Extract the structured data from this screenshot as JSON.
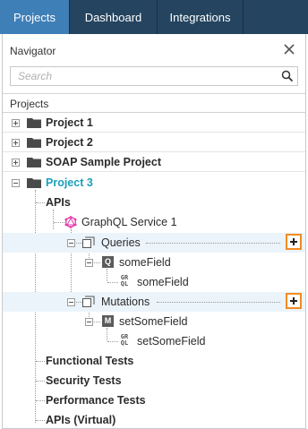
{
  "tabs": [
    {
      "label": "Projects",
      "active": true
    },
    {
      "label": "Dashboard",
      "active": false
    },
    {
      "label": "Integrations",
      "active": false
    }
  ],
  "navigator": {
    "title": "Navigator",
    "search_placeholder": "Search",
    "tree_heading": "Projects"
  },
  "projects": [
    {
      "label": "Project 1",
      "expanded": false
    },
    {
      "label": "Project 2",
      "expanded": false
    },
    {
      "label": "SOAP Sample Project",
      "expanded": false
    },
    {
      "label": "Project 3",
      "expanded": true
    }
  ],
  "tree": {
    "apis": "APIs",
    "graphql_service": "GraphQL Service 1",
    "queries": "Queries",
    "query_field": "someField",
    "query_field_op": "someField",
    "mutations": "Mutations",
    "mutation_field": "setSomeField",
    "mutation_field_op": "setSomeField",
    "functional_tests": "Functional Tests",
    "security_tests": "Security Tests",
    "performance_tests": "Performance Tests",
    "apis_virtual": "APIs (Virtual)"
  },
  "icons": {
    "query_badge": "Q",
    "mutation_badge": "M",
    "graphql_top": "GR",
    "graphql_bottom": "QL"
  },
  "colors": {
    "tabbar": "#24445f",
    "active_tab": "#3f7fb8",
    "active_project": "#1ba0b8",
    "highlight_row": "#ebf4fb",
    "add_button_border": "#f28b21",
    "graphql_icon": "#e535ab"
  }
}
